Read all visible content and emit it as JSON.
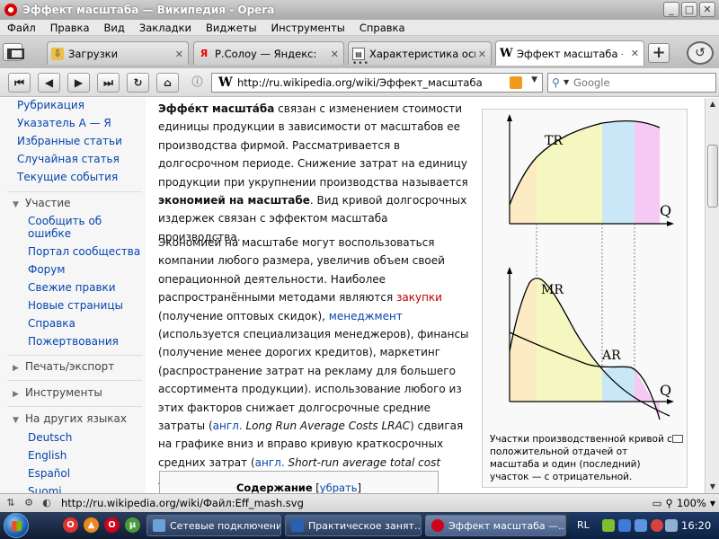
{
  "window": {
    "title": "Эффект масштаба — Википедия - Opera",
    "minimize": "_",
    "maximize": "□",
    "close": "✕"
  },
  "menu": [
    "Файл",
    "Правка",
    "Вид",
    "Закладки",
    "Виджеты",
    "Инструменты",
    "Справка"
  ],
  "tabs": [
    {
      "label": "Загрузки",
      "icon": "download-icon"
    },
    {
      "label": "Р.Солоу — Яндекс: нашлось",
      "icon": "yandex-icon"
    },
    {
      "label": "Характеристика основных",
      "icon": "document-icon"
    },
    {
      "label": "Эффект масштаба — Википедия",
      "icon": "wikipedia-icon",
      "active": true
    }
  ],
  "tab_dots": "•••",
  "nav": {
    "url": "http://ru.wikipedia.org/wiki/Эффект_масштаба",
    "search_placeholder": "Google",
    "wiki_mark": "W"
  },
  "sidebar": {
    "links1": [
      "Рубрикация",
      "Указатель А — Я",
      "Избранные статьи",
      "Случайная статья",
      "Текущие события"
    ],
    "participation_head": "Участие",
    "participation": [
      "Сообщить об",
      "ошибке",
      "Портал сообщества",
      "Форум",
      "Свежие правки",
      "Новые страницы",
      "Справка",
      "Пожертвования"
    ],
    "print_head": "Печать/экспорт",
    "tools_head": "Инструменты",
    "lang_head": "На других языках",
    "langs": [
      "Deutsch",
      "English",
      "Español",
      "Suomi"
    ]
  },
  "article": {
    "p1": {
      "lead_bold": "Эффе́кт масшта́ба",
      "text1": " связан с изменением стоимости единицы продукции в зависимости от масштабов ее производства фирмой. Рассматривается в долгосрочном периоде. Снижение затрат на единицу продукции при укрупнении производства называется ",
      "bold2": "экономией на масштабе",
      "text2": ". Вид кривой долгосрочных издержек связан с эффектом масштаба производства."
    },
    "p2": {
      "t1": "Экономией на масштабе могут воспользоваться компании любого размера, увеличив объем своей операционной деятельности. Наиболее распространёнными методами являются ",
      "link_red": "закупки",
      "t2": " (получение оптовых скидок), ",
      "link_mgmt": "менеджмент",
      "t3": " (используется специализация менеджеров), финансы (получение менее дорогих кредитов), маркетинг (распространение затрат на рекламу для большего ассортимента продукции). использование любого из этих факторов снижает долгосрочные средние затраты (",
      "link_en1": "англ.",
      "it1": " Long Run Average Costs LRAC",
      "t4": ") сдвигая на графике вниз и вправо кривую краткосрочных средних затрат (",
      "link_en2": "англ.",
      "it2": " Short-run average total cost SRATC",
      "t5": ")."
    },
    "toc_title": "Содержание",
    "toc_hide_open": "[",
    "toc_hide": "убрать",
    "toc_hide_close": "]"
  },
  "figure": {
    "top_label": "TR",
    "top_axis": "Q",
    "mr_label": "MR",
    "ar_label": "AR",
    "bottom_axis": "Q",
    "caption": "Участки производственной кривой с положительной отдачей от масштаба и один (последний) участок — с отрицательной.",
    "colors": {
      "zone1": "#fdebc3",
      "zone2": "#f4f7c0",
      "zone3": "#c9e7f7",
      "zone4": "#f6c9f4"
    }
  },
  "status": {
    "url": "http://ru.wikipedia.org/wiki/Файл:Eff_mash.svg",
    "zoom": "100%"
  },
  "taskbar": {
    "tasks": [
      "Сетевые подключения",
      "Практическое занят...",
      "Эффект масштаба —..."
    ],
    "lang": "RL",
    "clock": "16:20"
  }
}
